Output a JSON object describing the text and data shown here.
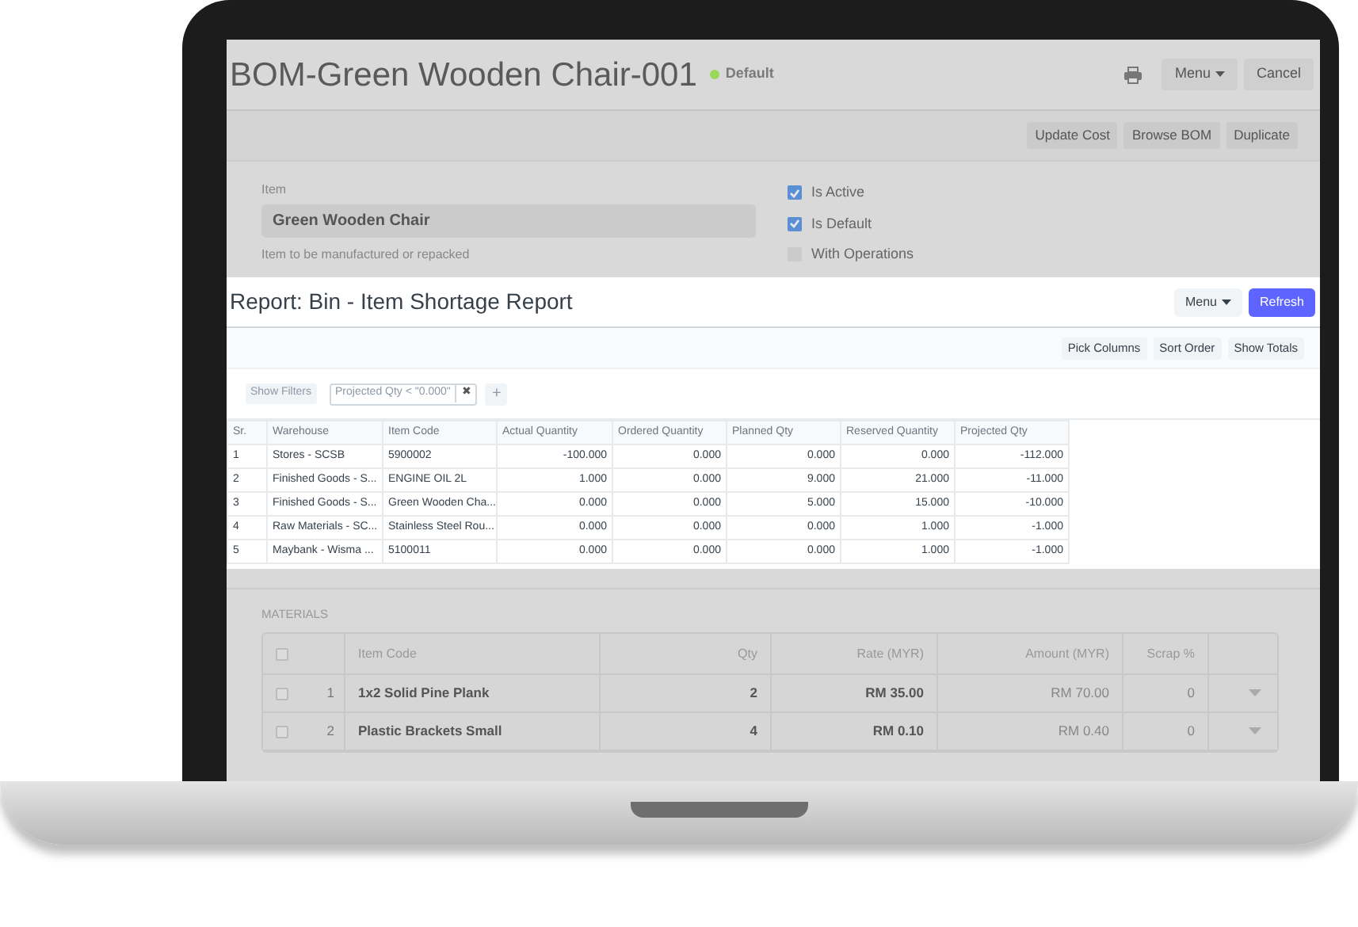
{
  "bom": {
    "title": "BOM-Green Wooden Chair-001",
    "status": {
      "label": "Default",
      "color": "#98d85b"
    },
    "header_buttons": [
      "Menu",
      "Cancel"
    ],
    "actions": [
      "Update Cost",
      "Browse BOM",
      "Duplicate"
    ],
    "item": {
      "label": "Item",
      "value": "Green Wooden Chair",
      "help": "Item to be manufactured or repacked"
    },
    "checks": [
      {
        "label": "Is Active",
        "checked": true
      },
      {
        "label": "Is Default",
        "checked": true
      },
      {
        "label": "With Operations",
        "checked": false
      }
    ]
  },
  "report": {
    "title": "Report: Bin - Item Shortage Report",
    "buttons": [
      "Menu",
      "Refresh"
    ],
    "toolbar": [
      "Pick Columns",
      "Sort Order",
      "Show Totals"
    ],
    "show_filters": "Show Filters",
    "filter": "Projected Qty < \"0.000\"",
    "filter_remove": "✖",
    "add_filter": "+",
    "columns": [
      "Sr.",
      "Warehouse",
      "Item Code",
      "Actual Quantity",
      "Ordered Quantity",
      "Planned Qty",
      "Reserved Quantity",
      "Projected Qty"
    ],
    "rows": [
      [
        "1",
        "Stores - SCSB",
        "5900002",
        "-100.000",
        "0.000",
        "0.000",
        "0.000",
        "-112.000"
      ],
      [
        "2",
        "Finished Goods - S...",
        "ENGINE OIL 2L",
        "1.000",
        "0.000",
        "9.000",
        "21.000",
        "-11.000"
      ],
      [
        "3",
        "Finished Goods - S...",
        "Green Wooden Cha...",
        "0.000",
        "0.000",
        "5.000",
        "15.000",
        "-10.000"
      ],
      [
        "4",
        "Raw Materials - SC...",
        "Stainless Steel Rou...",
        "0.000",
        "0.000",
        "0.000",
        "1.000",
        "-1.000"
      ],
      [
        "5",
        "Maybank - Wisma ...",
        "5100011",
        "0.000",
        "0.000",
        "0.000",
        "1.000",
        "-1.000"
      ]
    ]
  },
  "materials": {
    "label": "MATERIALS",
    "select_all_checked": false,
    "columns": [
      "Item Code",
      "Qty",
      "Rate (MYR)",
      "Amount (MYR)",
      "Scrap %"
    ],
    "rows": [
      {
        "checked": false,
        "idx": "1",
        "item_code": "1x2 Solid Pine Plank",
        "qty": "2",
        "rate": "RM 35.00",
        "amount": "RM 70.00",
        "scrap": "0"
      },
      {
        "checked": false,
        "idx": "2",
        "item_code": "Plastic Brackets Small",
        "qty": "4",
        "rate": "RM 0.10",
        "amount": "RM 0.40",
        "scrap": "0"
      }
    ]
  }
}
